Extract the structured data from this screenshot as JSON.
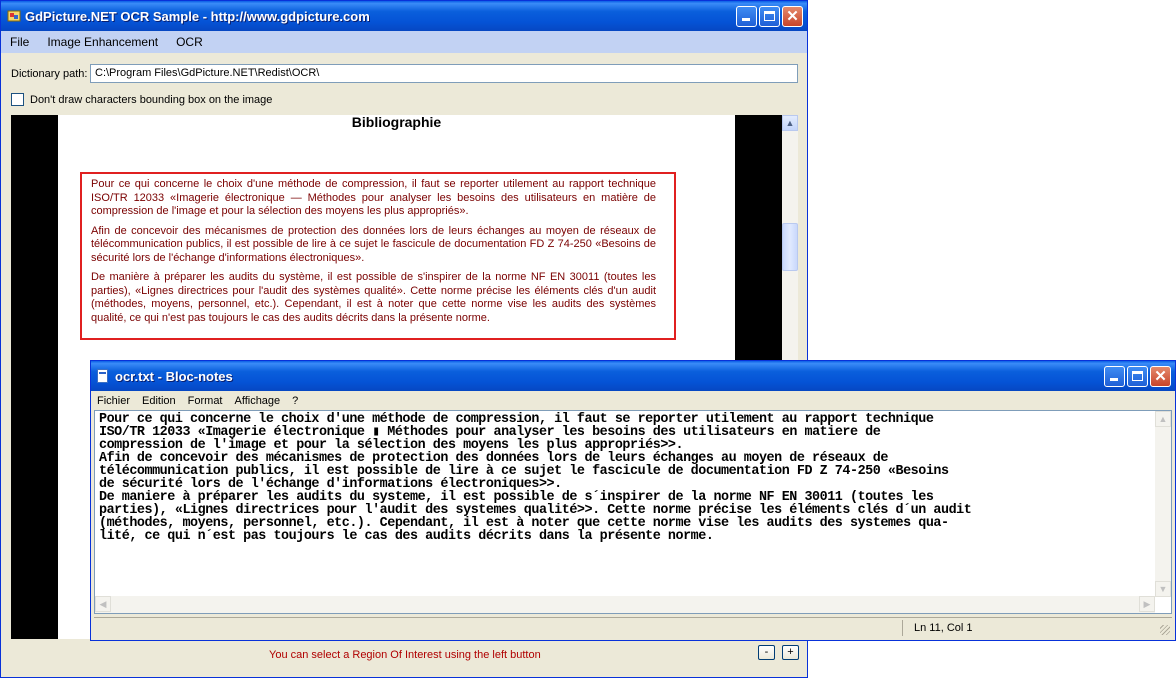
{
  "main_window": {
    "title": "GdPicture.NET OCR Sample  -  http://www.gdpicture.com",
    "menu": [
      "File",
      "Image Enhancement",
      "OCR"
    ],
    "dictionary_label": "Dictionary path:",
    "dictionary_value": "C:\\Program Files\\GdPicture.NET\\Redist\\OCR\\",
    "checkbox_label": "Don't draw characters bounding box on the image",
    "checkbox_checked": false,
    "document": {
      "title": "Bibliographie",
      "paragraphs": [
        "Pour ce qui concerne le choix d'une méthode de compression, il faut se reporter utilement au rapport technique ISO/TR 12033 «Imagerie électronique — Méthodes pour analyser les besoins des utilisateurs en matière de compression de l'image et pour la sélection des moyens les plus appropriés».",
        "Afin de concevoir des mécanismes de protection des données lors de leurs échanges au moyen de réseaux de télécommunication publics, il est possible de lire à ce sujet le fascicule de documentation FD Z 74-250 «Besoins de sécurité lors de l'échange d'informations électroniques».",
        "De manière à préparer les audits du système, il est possible de s'inspirer de la norme NF EN 30011 (toutes les parties), «Lignes directrices pour l'audit des systèmes qualité». Cette norme précise les éléments clés d'un audit (méthodes, moyens, personnel, etc.). Cependant, il est à noter que cette norme vise les audits des systèmes qualité, ce qui n'est pas toujours le cas des audits décrits dans la présente norme."
      ]
    },
    "status_text": "You can select a Region Of Interest using the left button",
    "zoom_out_label": "-",
    "zoom_in_label": "+",
    "colors": {
      "roi_border": "#e02020",
      "status_text": "#b00000",
      "titlebar": "#0553d6"
    }
  },
  "notepad": {
    "title": "ocr.txt - Bloc-notes",
    "menu": [
      "Fichier",
      "Edition",
      "Format",
      "Affichage",
      "?"
    ],
    "text": "Pour ce qui concerne le choix d'une méthode de compression, il faut se reporter utilement au rapport technique\nISO/TR 12033 «Imagerie électronique ▮ Méthodes pour analyser les besoins des utilisateurs en matiere de\ncompression de l'image et pour la sélection des moyens les plus appropriés>>.\nAfin de concevoir des mécanismes de protection des données lors de leurs échanges au moyen de réseaux de\ntélécommunication publics, il est possible de lire à ce sujet le fascicule de documentation FD Z 74-250 «Besoins\nde sécurité lors de l'échange d'informations électroniques>>.\nDe maniere à préparer les audits du systeme, il est possible de s´inspirer de la norme NF EN 30011 (toutes les\nparties), «Lignes directrices pour l'audit des systemes qualité>>. Cette norme précise les éléments clés d´un audit\n(méthodes, moyens, personnel, etc.). Cependant, il est à noter que cette norme vise les audits des systemes qua-\nlité, ce qui n´est pas toujours le cas des audits décrits dans la présente norme.",
    "status_position": "Ln 11, Col 1"
  }
}
